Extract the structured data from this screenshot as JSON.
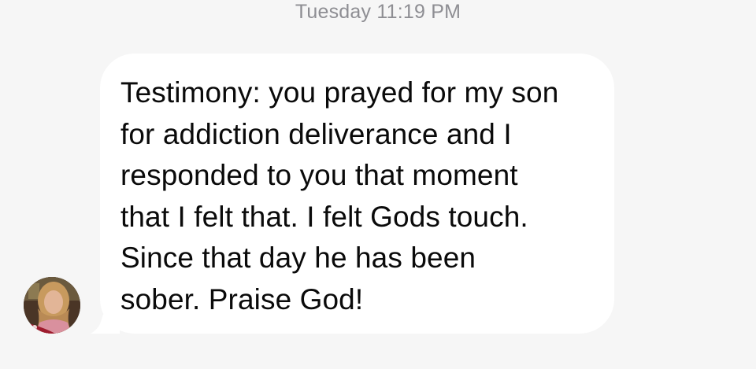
{
  "conversation": {
    "timestamp": {
      "day": "Tuesday",
      "time": "11:19 PM"
    },
    "messages": [
      {
        "direction": "incoming",
        "sender_avatar": "contact-avatar-photo",
        "text": "Testimony: you prayed for my son\nfor addiction deliverance and I\nresponded to you that moment\nthat I felt that. I felt Gods touch.\nSince that day he has been\nsober. Praise God!"
      }
    ]
  },
  "colors": {
    "background": "#f6f6f6",
    "bubble": "#ffffff",
    "timestamp": "#8e8e93",
    "text": "#0a0a0a"
  }
}
